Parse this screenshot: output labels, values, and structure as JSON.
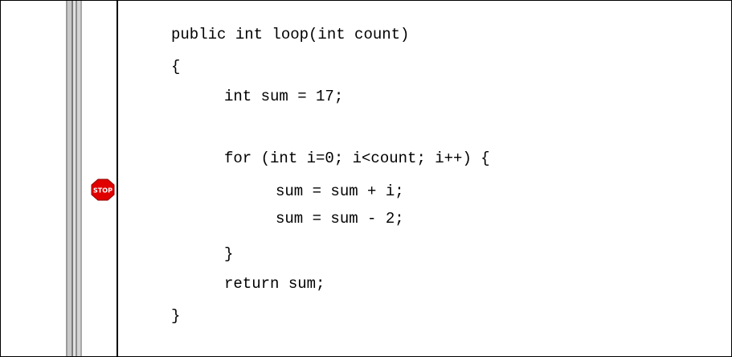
{
  "editor": {
    "breakpoint": {
      "icon": "stop-sign-icon",
      "label": "STOP",
      "color": "#e00000"
    },
    "code_lines": [
      "public int loop(int count)",
      "{",
      "int sum = 17;",
      "",
      "for (int i=0; i<count; i++) {",
      "sum = sum + i;",
      "sum = sum - 2;",
      "}",
      "return sum;",
      "}"
    ]
  }
}
